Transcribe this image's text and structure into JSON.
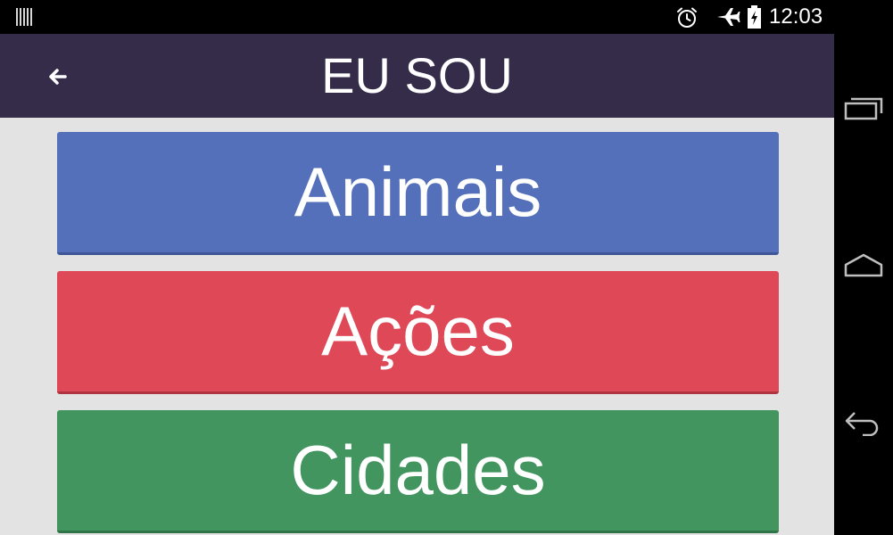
{
  "status_bar": {
    "time": "12:03",
    "icons": [
      "notification-bars-icon",
      "alarm-icon",
      "airplane-mode-icon",
      "battery-charging-icon"
    ]
  },
  "app_bar": {
    "title": "EU SOU",
    "back_icon": "arrow-left-icon"
  },
  "categories": [
    {
      "label": "Animais",
      "color": "#5570bb"
    },
    {
      "label": "Ações",
      "color": "#df4957"
    },
    {
      "label": "Cidades",
      "color": "#43955f"
    }
  ],
  "nav_bar": {
    "icons": [
      "recents-icon",
      "home-icon",
      "back-icon"
    ]
  },
  "colors": {
    "app_bar": "#352c4a",
    "content_background": "#e3e3e3",
    "system_bars": "#000000"
  }
}
